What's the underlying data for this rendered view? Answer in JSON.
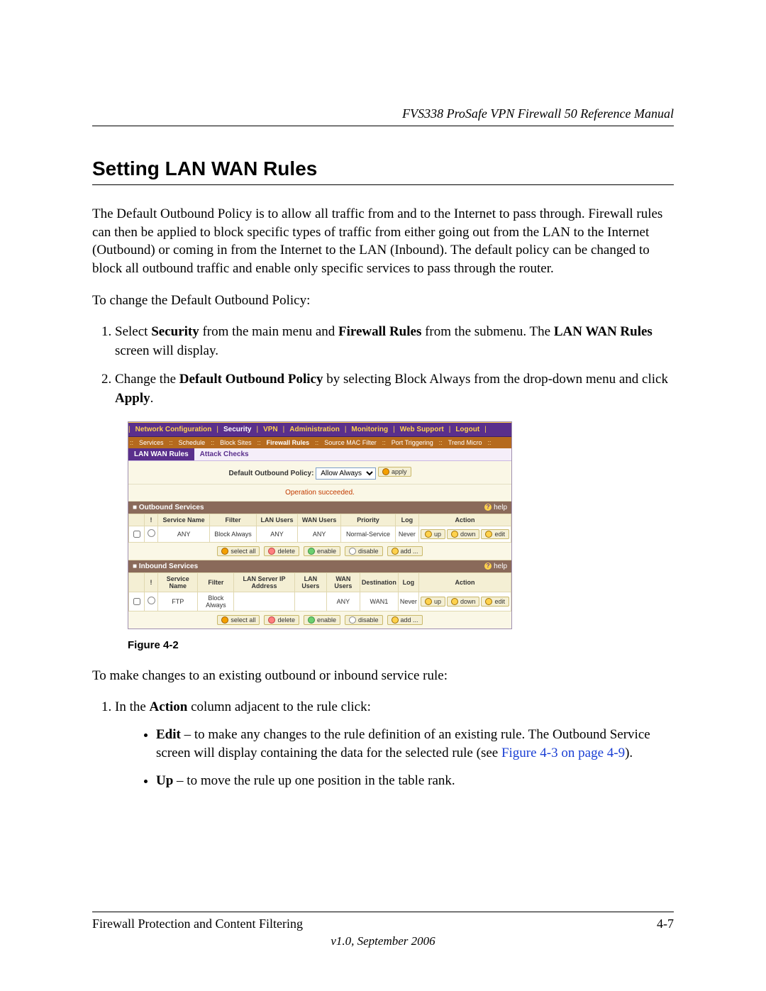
{
  "header": {
    "title": "FVS338 ProSafe VPN Firewall 50 Reference Manual"
  },
  "section": {
    "title": "Setting LAN WAN Rules"
  },
  "para1": "The Default Outbound Policy is to allow all traffic from and to the Internet to pass through. Firewall rules can then be applied to block specific types of traffic from either going out from the LAN to the Internet (Outbound) or coming in from the Internet to the LAN (Inbound). The default policy can be changed to block all outbound traffic and enable only specific services to pass through the router.",
  "para2": "To change the Default Outbound Policy:",
  "step1": {
    "pre": "Select ",
    "b1": "Security",
    "mid1": " from the main menu and ",
    "b2": "Firewall Rules",
    "mid2": " from the submenu. The ",
    "b3": "LAN WAN Rules",
    "post": " screen will display."
  },
  "step2": {
    "pre": "Change the ",
    "b1": "Default Outbound Policy",
    "mid": " by selecting Block Always from the drop-down menu and click ",
    "b2": "Apply",
    "post": "."
  },
  "figure": {
    "caption": "Figure 4-2"
  },
  "para3": "To make changes to an existing outbound or inbound service rule:",
  "step3": {
    "pre": "In the ",
    "b1": "Action",
    "post": " column adjacent to the rule click:"
  },
  "bullet1": {
    "b1": "Edit",
    "text": " – to make any changes to the rule definition of an existing rule. The Outbound Service screen will display containing the data for the selected rule (see ",
    "link": "Figure 4-3 on page 4-9",
    "after": ")."
  },
  "bullet2": {
    "b1": "Up",
    "text": " – to move the rule up one position in the table rank."
  },
  "footer": {
    "left": "Firewall Protection and Content Filtering",
    "right": "4-7",
    "version": "v1.0, September 2006"
  },
  "ui": {
    "nav_top": [
      "Network Configuration",
      "Security",
      "VPN",
      "Administration",
      "Monitoring",
      "Web Support",
      "Logout"
    ],
    "nav_sub": [
      "Services",
      "Schedule",
      "Block Sites",
      "Firewall Rules",
      "Source MAC Filter",
      "Port Triggering",
      "Trend Micro"
    ],
    "tabs": {
      "active": "LAN WAN Rules",
      "other": "Attack Checks"
    },
    "policy": {
      "label": "Default Outbound Policy:",
      "value": "Allow Always",
      "apply": "apply"
    },
    "status": "Operation succeeded.",
    "help": "help",
    "buttons": {
      "select_all": "select all",
      "delete": "delete",
      "enable": "enable",
      "disable": "disable",
      "add": "add ...",
      "up": "up",
      "down": "down",
      "edit": "edit"
    },
    "outbound": {
      "title": "Outbound Services",
      "cols": [
        "",
        "!",
        "Service Name",
        "Filter",
        "LAN Users",
        "WAN Users",
        "Priority",
        "Log",
        "Action"
      ],
      "row": {
        "service": "ANY",
        "filter": "Block Always",
        "lan": "ANY",
        "wan": "ANY",
        "priority": "Normal-Service",
        "log": "Never"
      }
    },
    "inbound": {
      "title": "Inbound Services",
      "cols": [
        "",
        "!",
        "Service Name",
        "Filter",
        "LAN Server IP Address",
        "LAN Users",
        "WAN Users",
        "Destination",
        "Log",
        "Action"
      ],
      "row": {
        "service": "FTP",
        "filter": "Block Always",
        "lan_ip": "",
        "lan": "",
        "wan": "ANY",
        "dest": "WAN1",
        "log": "Never"
      }
    }
  },
  "chart_data": {
    "type": "table",
    "tables": [
      {
        "name": "Outbound Services",
        "columns": [
          "Service Name",
          "Filter",
          "LAN Users",
          "WAN Users",
          "Priority",
          "Log"
        ],
        "rows": [
          [
            "ANY",
            "Block Always",
            "ANY",
            "ANY",
            "Normal-Service",
            "Never"
          ]
        ]
      },
      {
        "name": "Inbound Services",
        "columns": [
          "Service Name",
          "Filter",
          "LAN Server IP Address",
          "LAN Users",
          "WAN Users",
          "Destination",
          "Log"
        ],
        "rows": [
          [
            "FTP",
            "Block Always",
            "",
            "",
            "ANY",
            "WAN1",
            "Never"
          ]
        ]
      }
    ],
    "default_outbound_policy": "Allow Always",
    "status_message": "Operation succeeded."
  }
}
